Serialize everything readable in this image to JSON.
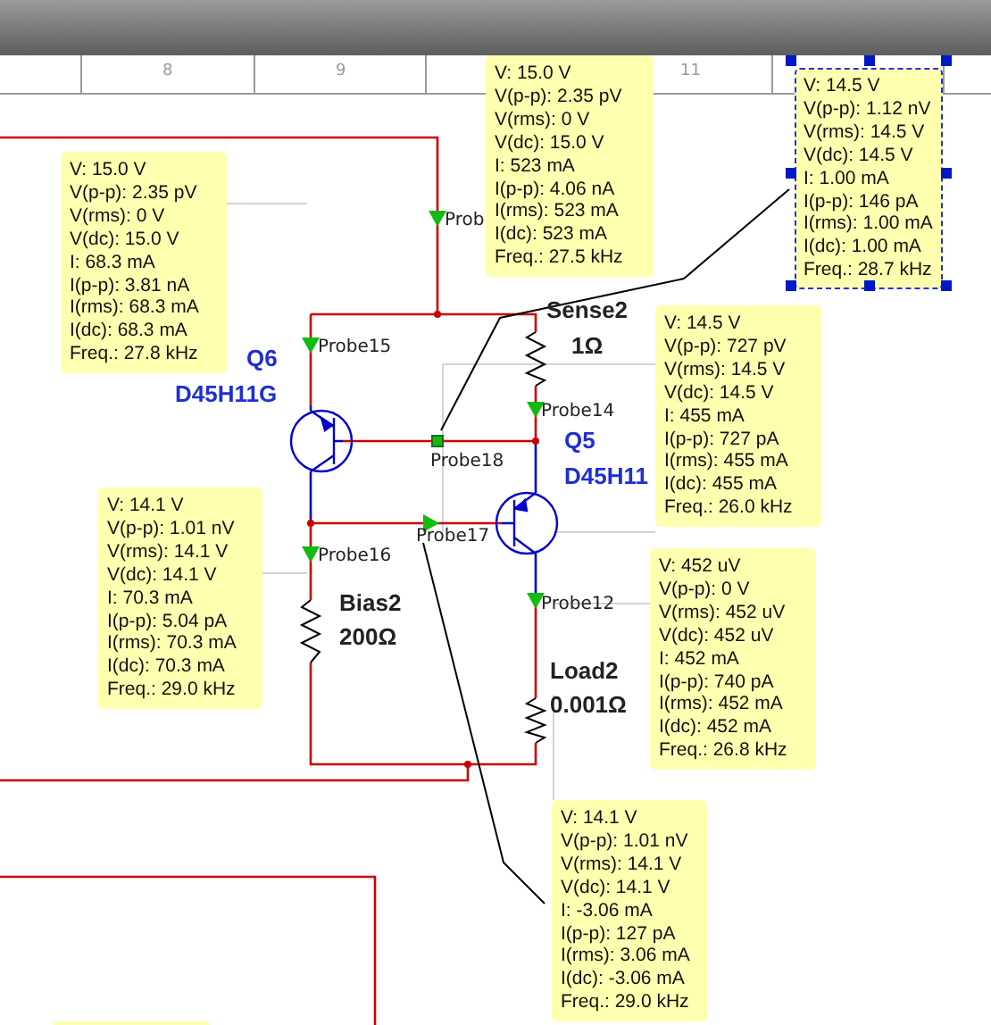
{
  "ruler": {
    "labels": [
      "8",
      "9",
      "11"
    ]
  },
  "probe_labels": [
    "Prob",
    "Probe15",
    "Probe18",
    "Probe14",
    "Probe16",
    "Probe17",
    "Probe12"
  ],
  "parts": [
    {
      "kind": "resistor",
      "name": "Sense2",
      "value": "1Ω"
    },
    {
      "kind": "transistor",
      "name": "Q6",
      "value": "D45H11G"
    },
    {
      "kind": "transistor",
      "name": "Q5",
      "value": "D45H11"
    },
    {
      "kind": "resistor",
      "name": "Bias2",
      "value": "200Ω"
    },
    {
      "kind": "resistor",
      "name": "Load2",
      "value": "0.001Ω"
    }
  ],
  "readouts": [
    {
      "selected": false,
      "lines": [
        "V: 15.0 V",
        "V(p-p): 2.35 pV",
        "V(rms): 0 V",
        "V(dc): 15.0 V",
        "I: 523 mA",
        "I(p-p): 4.06 nA",
        "I(rms): 523 mA",
        "I(dc): 523 mA",
        "Freq.: 27.5 kHz"
      ]
    },
    {
      "selected": true,
      "lines": [
        "V: 14.5 V",
        "V(p-p): 1.12 nV",
        "V(rms): 14.5 V",
        "V(dc): 14.5 V",
        "I: 1.00 mA",
        "I(p-p): 146 pA",
        "I(rms): 1.00 mA",
        "I(dc): 1.00 mA",
        "Freq.: 28.7 kHz"
      ]
    },
    {
      "selected": false,
      "lines": [
        "V: 15.0 V",
        "V(p-p): 2.35 pV",
        "V(rms): 0 V",
        "V(dc): 15.0 V",
        "I: 68.3 mA",
        "I(p-p): 3.81 nA",
        "I(rms): 68.3 mA",
        "I(dc): 68.3 mA",
        "Freq.: 27.8 kHz"
      ]
    },
    {
      "selected": false,
      "lines": [
        "V: 14.5 V",
        "V(p-p): 727 pV",
        "V(rms): 14.5 V",
        "V(dc): 14.5 V",
        "I: 455 mA",
        "I(p-p): 727 pA",
        "I(rms): 455 mA",
        "I(dc): 455 mA",
        "Freq.: 26.0 kHz"
      ]
    },
    {
      "selected": false,
      "lines": [
        "V: 14.1 V",
        "V(p-p): 1.01 nV",
        "V(rms): 14.1 V",
        "V(dc): 14.1 V",
        "I: 70.3 mA",
        "I(p-p): 5.04 pA",
        "I(rms): 70.3 mA",
        "I(dc): 70.3 mA",
        "Freq.: 29.0 kHz"
      ]
    },
    {
      "selected": false,
      "lines": [
        "V: 452 uV",
        "V(p-p): 0 V",
        "V(rms): 452 uV",
        "V(dc): 452 uV",
        "I: 452 mA",
        "I(p-p): 740 pA",
        "I(rms): 452 mA",
        "I(dc): 452 mA",
        "Freq.: 26.8 kHz"
      ]
    },
    {
      "selected": false,
      "lines": [
        "V: 14.1 V",
        "V(p-p): 1.01 nV",
        "V(rms): 14.1 V",
        "V(dc): 14.1 V",
        "I: -3.06 mA",
        "I(p-p): 127 pA",
        "I(rms): 3.06 mA",
        "I(dc): -3.06 mA",
        "Freq.: 29.0 kHz"
      ]
    }
  ]
}
